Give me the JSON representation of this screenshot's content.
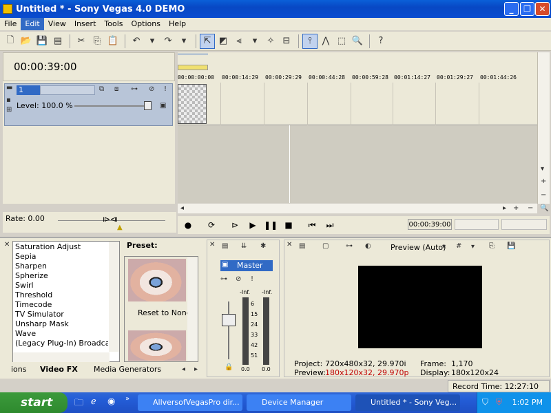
{
  "window": {
    "title": "Untitled * - Sony Vegas 4.0 DEMO"
  },
  "menu": [
    "File",
    "Edit",
    "View",
    "Insert",
    "Tools",
    "Options",
    "Help"
  ],
  "timeline": {
    "timecode": "00:00:39:00",
    "ticks": [
      "00:00:00:00",
      "00:00:14:29",
      "00:00:29:29",
      "00:00:44:28",
      "00:00:59:28",
      "00:01:14:27",
      "00:01:29:27",
      "00:01:44:26"
    ]
  },
  "track": {
    "number": "1",
    "level": "Level: 100.0 %"
  },
  "rate": "Rate: 0.00",
  "transport": {
    "timecode": "00:00:39:00"
  },
  "fx": {
    "items": [
      "Saturation Adjust",
      "Sepia",
      "Sharpen",
      "Spherize",
      "Swirl",
      "Threshold",
      "Timecode",
      "TV Simulator",
      "Unsharp Mask",
      "Wave",
      "(Legacy Plug-In) Broadcast C"
    ],
    "preset_label": "Preset:",
    "reset": "Reset to None"
  },
  "tabs": [
    "ions",
    "Video FX",
    "Media Generators"
  ],
  "mixer": {
    "master": "Master",
    "inf_left": "-Inf.",
    "inf_right": "-Inf.",
    "scale": [
      "6",
      "15",
      "24",
      "33",
      "42",
      "51"
    ],
    "left_val": "0.0",
    "right_val": "0.0"
  },
  "preview": {
    "dropdown": "Preview (Auto)",
    "project_label": "Project:",
    "project_value": "720x480x32, 29.970i",
    "preview_label": "Preview:",
    "preview_value": "180x120x32, 29.970p",
    "frame_label": "Frame:",
    "frame_value": "1,170",
    "display_label": "Display:",
    "display_value": "180x120x24",
    "preview_color": "#c00000"
  },
  "status": {
    "record_time": "Record Time: 12:27:10"
  },
  "taskbar": {
    "start": "start",
    "tasks": [
      "AllversofVegasPro dir...",
      "Device Manager",
      "Untitled * - Sony Veg..."
    ],
    "clock": "1:02 PM"
  }
}
